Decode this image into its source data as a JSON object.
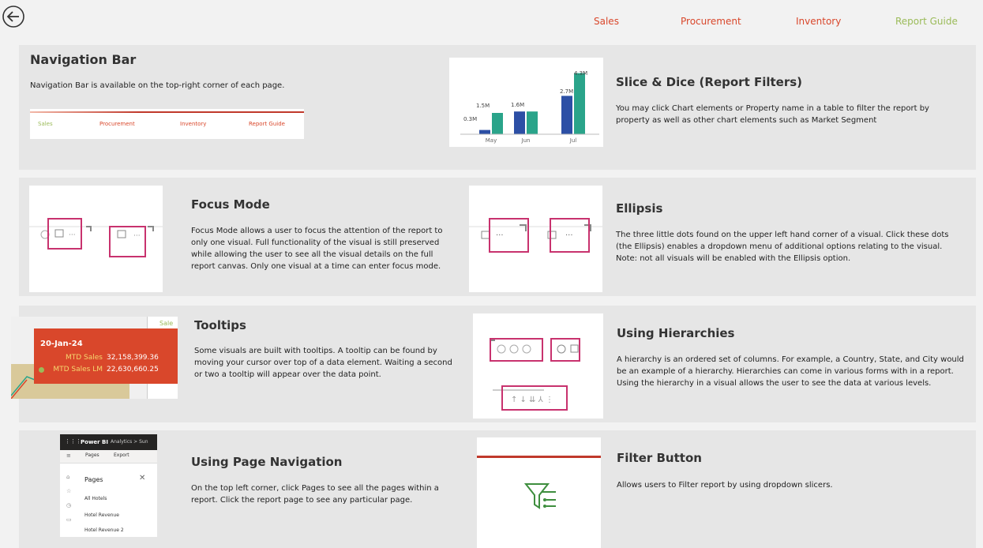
{
  "colors": {
    "accent_red": "#d9472b",
    "report_guide": "#9bbb59",
    "highlight": "#c8326e",
    "teal": "#2aa48a",
    "navy": "#2c4fa5"
  },
  "header": {
    "back_icon": "back-arrow-icon",
    "nav": [
      "Sales",
      "Procurement",
      "Inventory",
      "Report Guide"
    ]
  },
  "nav_bar": {
    "title": "Navigation Bar",
    "desc": "Navigation Bar is available on the top-right corner of each page.",
    "mini_nav": [
      "Sales",
      "Procurement",
      "Inventory",
      "Report Guide"
    ]
  },
  "slice": {
    "title": "Slice & Dice (Report Filters)",
    "desc": "You may click Chart elements or Property name in a table to filter the report by property as well as other chart elements such as Market Segment",
    "chart_data": {
      "type": "bar",
      "categories": [
        "May",
        "Jun",
        "Jul"
      ],
      "series": [
        {
          "values": [
            0.3,
            1.6,
            2.7
          ]
        },
        {
          "values": [
            1.5,
            1.6,
            4.3
          ]
        }
      ],
      "labels": [
        "0.3M",
        "1.5M",
        "1.6M",
        "2.7M",
        "4.3M"
      ]
    }
  },
  "focus": {
    "title": "Focus Mode",
    "desc": "Focus Mode allows a user to focus the attention of the report to only one visual.  Full functionality of the visual is still preserved while allowing the user to see all the visual details on the full report canvas.  Only one visual at a time can enter focus mode."
  },
  "ellipsis": {
    "title": "Ellipsis",
    "desc": "The three little dots found on the upper left hand corner of a visual.  Click these dots (the Ellipsis) enables a dropdown menu of additional options relating to the visual.  Note: not all visuals will be enabled with the Ellipsis option."
  },
  "tooltips": {
    "title": "Tooltips",
    "desc": "Some visuals are built with tooltips.  A tooltip can be found by moving your cursor over top of a data element.  Waiting a second or two a tooltip will appear over the data point.",
    "tip": {
      "date": "20-Jan-24",
      "row1_label": "MTD Sales",
      "row1_value": "32,158,399.36",
      "row2_label": "MTD Sales LM",
      "row2_value": "22,630,660.25"
    },
    "bg_label": "Sale"
  },
  "hierarchies": {
    "title": "Using Hierarchies",
    "desc": "A hierarchy is an ordered set of columns.  For example, a Country, State, and City would be an example of a hierarchy.  Hierarchies can come in various forms with in a report.  Using the hierarchy in a visual allows the user to see the data at various levels."
  },
  "page_nav": {
    "title": "Using Page Navigation",
    "desc": "On the top left corner, click Pages to see all the pages within a report. Click the report page to see any particular page.",
    "pbi": {
      "brand": "Power BI",
      "crumb": "Analytics  >  Sun",
      "pages_btn": "Pages",
      "export_btn": "Export",
      "pages_title": "Pages",
      "items": [
        "All Hotels",
        "Hotel Revenue",
        "Hotel Revenue 2"
      ]
    }
  },
  "filter": {
    "title": "Filter Button",
    "desc": "Allows users to Filter report by using dropdown slicers."
  }
}
